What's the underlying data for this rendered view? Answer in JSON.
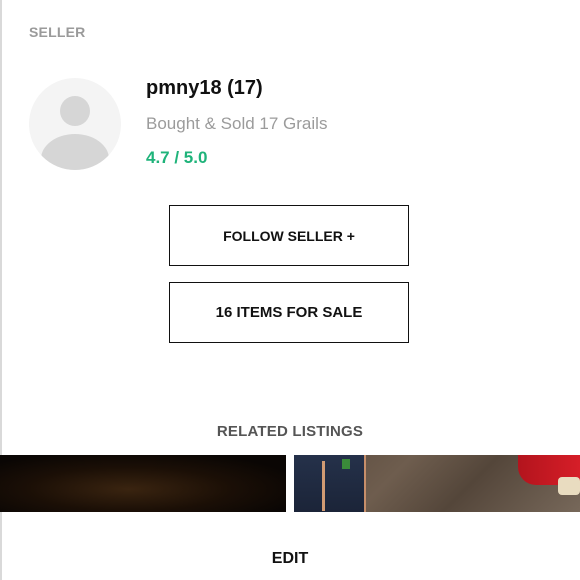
{
  "section": {
    "label": "SELLER"
  },
  "seller": {
    "username": "pmny18 (17)",
    "tagline": "Bought & Sold 17 Grails",
    "rating": "4.7 / 5.0",
    "avatar_icon": "user-placeholder-icon"
  },
  "buttons": {
    "follow_label": "FOLLOW SELLER +",
    "items_label": "16 ITEMS FOR SALE"
  },
  "related": {
    "heading": "RELATED LISTINGS"
  },
  "footer": {
    "edit_label": "EDIT"
  },
  "colors": {
    "rating": "#1fb37a",
    "muted": "#9b9b9b"
  }
}
